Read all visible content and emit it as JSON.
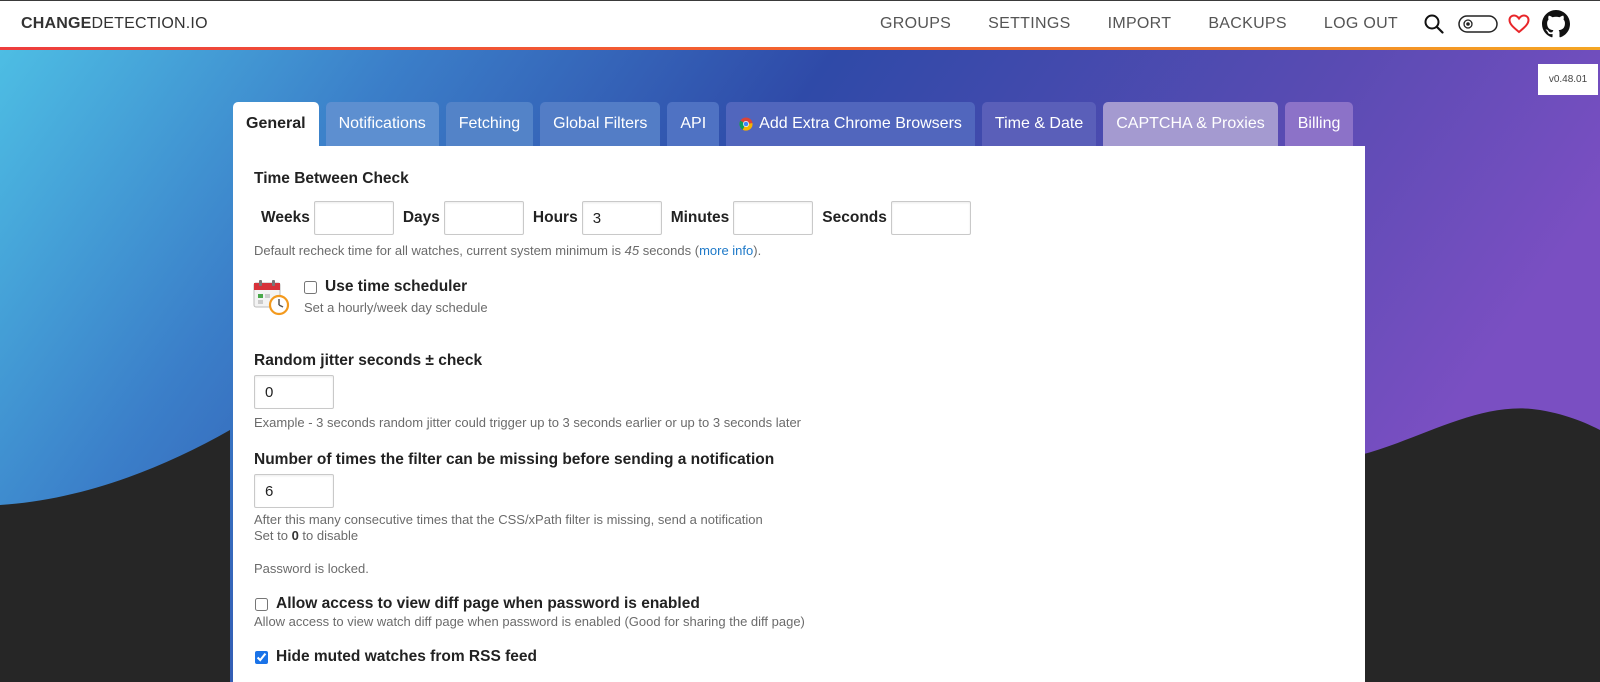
{
  "brand": {
    "bold": "CHANGE",
    "rest": "DETECTION.IO"
  },
  "nav": {
    "items": [
      "GROUPS",
      "SETTINGS",
      "IMPORT",
      "BACKUPS",
      "LOG OUT"
    ],
    "icons": [
      "search-icon",
      "dark-mode-toggle-icon",
      "heart-icon",
      "github-icon"
    ]
  },
  "version": "v0.48.01",
  "tabs": [
    {
      "label": "General",
      "active": true
    },
    {
      "label": "Notifications"
    },
    {
      "label": "Fetching"
    },
    {
      "label": "Global Filters"
    },
    {
      "label": "API"
    },
    {
      "label": "Add Extra Chrome Browsers",
      "icon": "chrome-icon"
    },
    {
      "label": "Time & Date"
    },
    {
      "label": "CAPTCHA & Proxies"
    },
    {
      "label": "Billing"
    }
  ],
  "general": {
    "time_between_check": {
      "title": "Time Between Check",
      "weeks_label": "Weeks",
      "weeks_value": "",
      "days_label": "Days",
      "days_value": "",
      "hours_label": "Hours",
      "hours_value": "3",
      "minutes_label": "Minutes",
      "minutes_value": "",
      "seconds_label": "Seconds",
      "seconds_value": "",
      "help_prefix": "Default recheck time for all watches, current system minimum is ",
      "help_min": "45",
      "help_mid": " seconds (",
      "help_link": "more info",
      "help_suffix": ")."
    },
    "scheduler": {
      "label": "Use time scheduler",
      "help": "Set a hourly/week day schedule",
      "checked": false,
      "icon": "calendar-clock-icon"
    },
    "jitter": {
      "title": "Random jitter seconds ± check",
      "value": "0",
      "help": "Example - 3 seconds random jitter could trigger up to 3 seconds earlier or up to 3 seconds later"
    },
    "filter_missing": {
      "title": "Number of times the filter can be missing before sending a notification",
      "value": "6",
      "help1": "After this many consecutive times that the CSS/xPath filter is missing, send a notification",
      "help2_prefix": "Set to ",
      "help2_bold": "0",
      "help2_suffix": " to disable"
    },
    "password_status": "Password is locked.",
    "diff_access": {
      "label": "Allow access to view diff page when password is enabled",
      "help": "Allow access to view watch diff page when password is enabled (Good for sharing the diff page)",
      "checked": false
    },
    "hide_muted": {
      "label": "Hide muted watches from RSS feed",
      "checked": true
    }
  },
  "colors": {
    "accent_link": "#1e79c8",
    "nav_underline": "#ed3d3d",
    "bg_dark": "#262626"
  }
}
